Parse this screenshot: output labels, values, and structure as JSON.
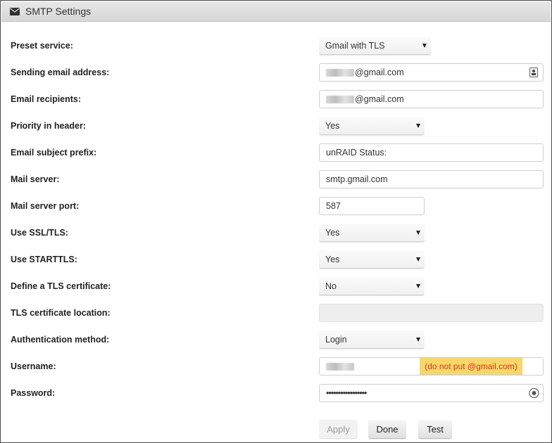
{
  "panel": {
    "title": "SMTP Settings",
    "title_icon": "envelope-icon"
  },
  "fields": {
    "preset_service": {
      "label": "Preset service:",
      "value": "Gmail with TLS"
    },
    "sending_email": {
      "label": "Sending email address:",
      "value": "@gmail.com",
      "icon": "contact-card-icon"
    },
    "email_recipients": {
      "label": "Email recipients:",
      "value": "@gmail.com"
    },
    "priority_header": {
      "label": "Priority in header:",
      "value": "Yes"
    },
    "subject_prefix": {
      "label": "Email subject prefix:",
      "value": "unRAID Status:"
    },
    "mail_server": {
      "label": "Mail server:",
      "value": "smtp.gmail.com"
    },
    "mail_server_port": {
      "label": "Mail server port:",
      "value": "587"
    },
    "use_ssl_tls": {
      "label": "Use SSL/TLS:",
      "value": "Yes"
    },
    "use_starttls": {
      "label": "Use STARTTLS:",
      "value": "Yes"
    },
    "tls_certificate": {
      "label": "Define a TLS certificate:",
      "value": "No"
    },
    "tls_cert_location": {
      "label": "TLS certificate location:",
      "value": ""
    },
    "auth_method": {
      "label": "Authentication method:",
      "value": "Login"
    },
    "username": {
      "label": "Username:",
      "value": "",
      "note": "(do not put @gmail.com)"
    },
    "password": {
      "label": "Password:",
      "value": "•••••••••••••••••",
      "icon": "show-password-icon"
    }
  },
  "buttons": {
    "apply": "Apply",
    "done": "Done",
    "test": "Test"
  },
  "colors": {
    "note_bg": "#f7d66a",
    "note_text": "#d83a1a"
  }
}
